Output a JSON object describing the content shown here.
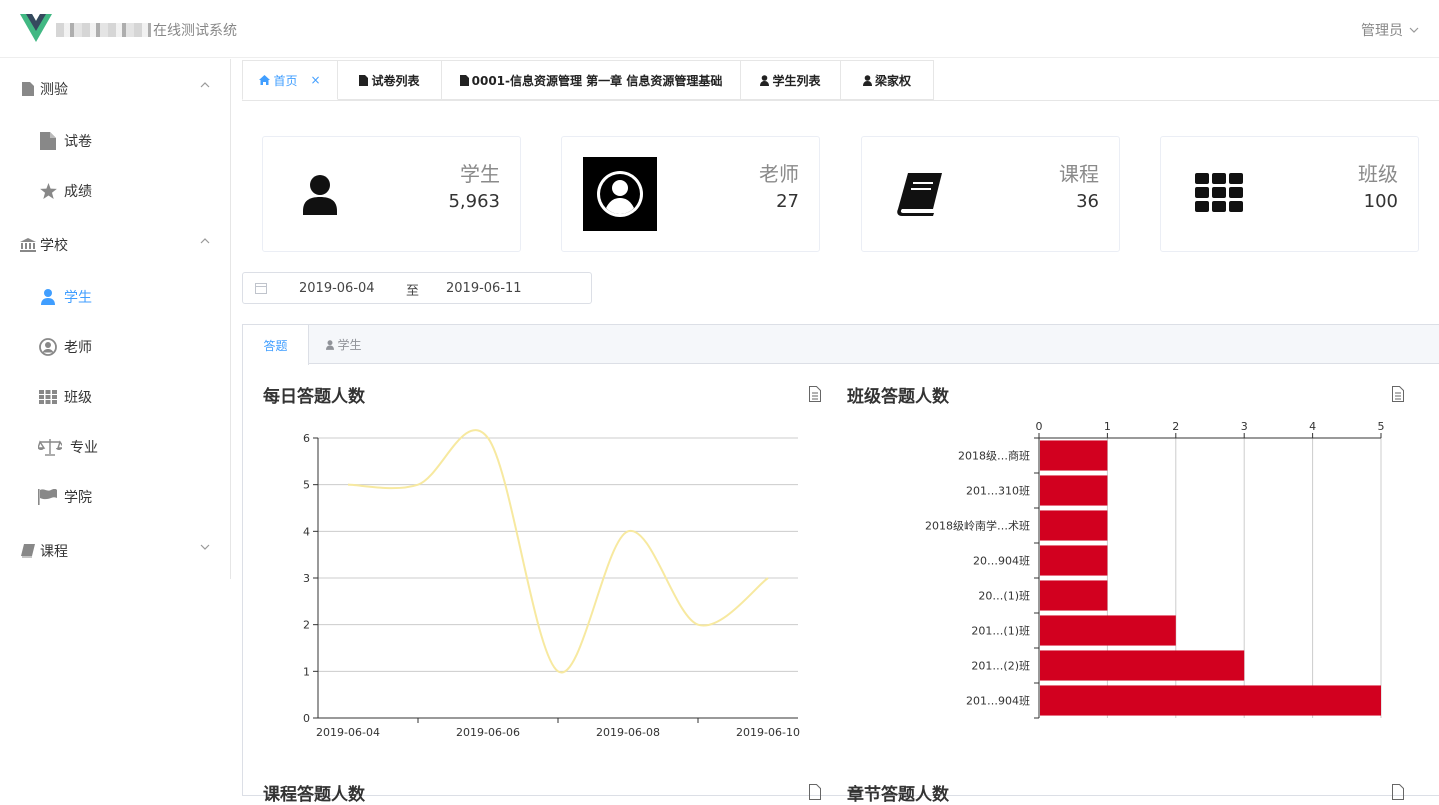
{
  "header": {
    "app_title": "在线测试系统",
    "user_label": "管理员"
  },
  "sidebar": {
    "groups": [
      {
        "label": "测验",
        "icon": "file-icon",
        "items": [
          {
            "label": "试卷",
            "icon": "file-icon"
          },
          {
            "label": "成绩",
            "icon": "star-icon"
          }
        ]
      },
      {
        "label": "学校",
        "icon": "bank-icon",
        "items": [
          {
            "label": "学生",
            "icon": "user-icon",
            "active": true
          },
          {
            "label": "老师",
            "icon": "user-circle-icon"
          },
          {
            "label": "班级",
            "icon": "grid-icon"
          },
          {
            "label": "专业",
            "icon": "balance-scale-icon"
          },
          {
            "label": "学院",
            "icon": "flag-icon"
          }
        ]
      },
      {
        "label": "课程",
        "icon": "book-icon",
        "items": []
      }
    ]
  },
  "tabs": [
    {
      "label": "首页",
      "icon": "home-icon",
      "closable": true
    },
    {
      "label": "试卷列表",
      "icon": "file-icon"
    },
    {
      "label": "0001-信息资源管理 第一章 信息资源管理基础",
      "icon": "file-icon"
    },
    {
      "label": "学生列表",
      "icon": "user-icon"
    },
    {
      "label": "梁家权",
      "icon": "user-icon"
    }
  ],
  "stats": [
    {
      "label": "学生",
      "value": "5,963",
      "icon": "user-icon"
    },
    {
      "label": "老师",
      "value": "27",
      "icon": "user-circle-icon"
    },
    {
      "label": "课程",
      "value": "36",
      "icon": "book-icon"
    },
    {
      "label": "班级",
      "value": "100",
      "icon": "th-icon"
    }
  ],
  "date_range": {
    "start": "2019-06-04",
    "separator": "至",
    "end": "2019-06-11"
  },
  "chart_tabs": [
    {
      "label": "答题",
      "active": true
    },
    {
      "label": "学生",
      "icon": "user-icon"
    }
  ],
  "sections": {
    "course_title": "课程答题人数",
    "chapter_title": "章节答题人数"
  },
  "colors": {
    "accent": "#409eff",
    "line": "#f7e9a0",
    "bar": "#d2001f"
  },
  "chart_data": [
    {
      "type": "line",
      "title": "每日答题人数",
      "x": [
        "2019-06-04",
        "2019-06-05",
        "2019-06-06",
        "2019-06-07",
        "2019-06-08",
        "2019-06-09",
        "2019-06-10"
      ],
      "x_tick_labels": [
        "2019-06-04",
        "2019-06-06",
        "2019-06-08",
        "2019-06-10"
      ],
      "values": [
        5,
        5,
        6,
        1,
        4,
        2,
        3
      ],
      "ylim": [
        0,
        6
      ],
      "yticks": [
        0,
        1,
        2,
        3,
        4,
        5,
        6
      ],
      "grid": true,
      "smooth": true
    },
    {
      "type": "bar",
      "orientation": "horizontal",
      "title": "班级答题人数",
      "categories": [
        "2018级…商班",
        "201…310班",
        "2018级岭南学…术班",
        "20…904班",
        "20…(1)班",
        "201…(1)班",
        "201…(2)班",
        "201…904班"
      ],
      "values": [
        1,
        1,
        1,
        1,
        1,
        2,
        3,
        5
      ],
      "xlim": [
        0,
        5
      ],
      "xticks": [
        0,
        1,
        2,
        3,
        4,
        5
      ],
      "grid": true
    }
  ]
}
